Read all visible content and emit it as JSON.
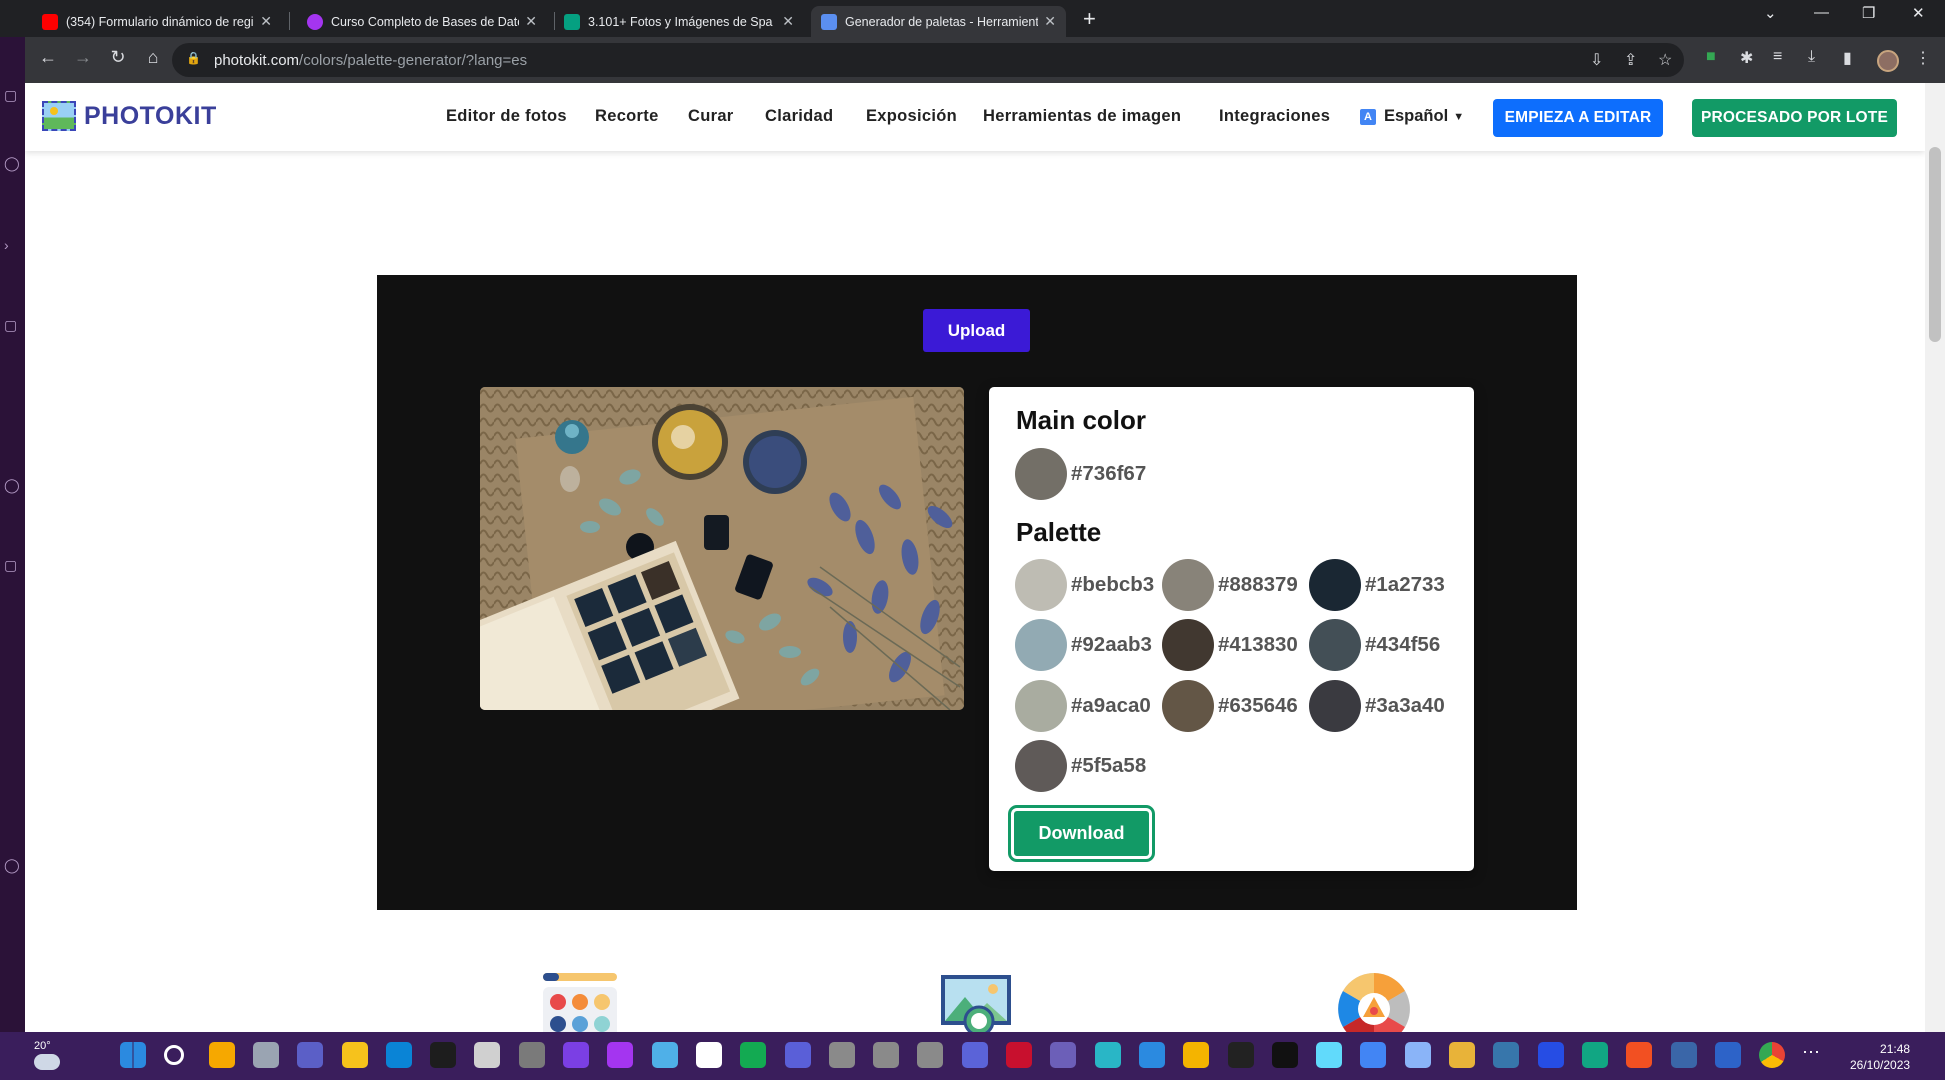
{
  "browser": {
    "tabs": [
      {
        "title": "(354) Formulario dinámico de regis",
        "fav_color": "#ff0000"
      },
      {
        "title": "Curso Completo de Bases de Datos",
        "fav_color": "#a435f0"
      },
      {
        "title": "3.101+ Fotos y Imágenes de Spa Gr",
        "fav_color": "#05a081"
      },
      {
        "title": "Generador de paletas - Herramient",
        "fav_color": "#5b8ff0",
        "active": true
      }
    ],
    "new_tab": "+",
    "url_host": "photokit.com",
    "url_path": "/colors/palette-generator/?lang=es"
  },
  "site": {
    "logo": "PHOTOKIT",
    "nav": [
      "Editor de fotos",
      "Recorte",
      "Curar",
      "Claridad",
      "Exposición",
      "Herramientas de imagen",
      "Integraciones"
    ],
    "language": "Español",
    "cta_edit": "EMPIEZA A EDITAR",
    "cta_batch": "PROCESADO POR LOTE"
  },
  "tool": {
    "upload_label": "Upload",
    "main_color_title": "Main color",
    "main_color": {
      "hex": "#736f67"
    },
    "palette_title": "Palette",
    "palette": [
      {
        "hex": "#bebcb3"
      },
      {
        "hex": "#888379"
      },
      {
        "hex": "#1a2733"
      },
      {
        "hex": "#92aab3"
      },
      {
        "hex": "#413830"
      },
      {
        "hex": "#434f56"
      },
      {
        "hex": "#a9aca0"
      },
      {
        "hex": "#635646"
      },
      {
        "hex": "#3a3a40"
      },
      {
        "hex": "#5f5a58"
      }
    ],
    "download_label": "Download"
  },
  "taskbar": {
    "weather": "20°",
    "time": "21:48",
    "date": "26/10/2023"
  }
}
